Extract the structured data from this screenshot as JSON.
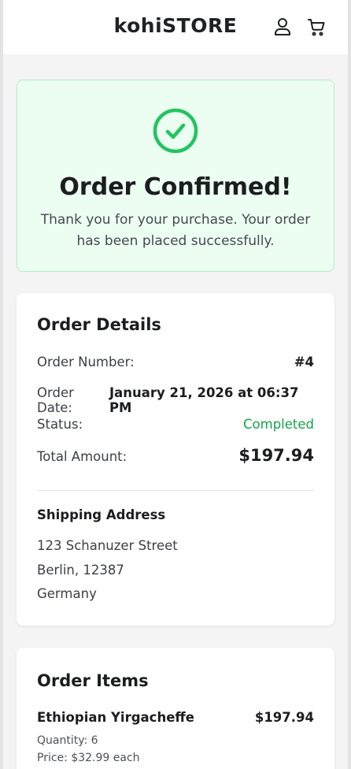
{
  "header": {
    "brand": "kohiSTORE",
    "icons": [
      "user-icon",
      "cart-icon"
    ]
  },
  "confirmation": {
    "icon": "check-circle-icon",
    "title": "Order Confirmed!",
    "message": "Thank you for your purchase. Your order has been placed successfully.",
    "accent_color": "#22c55e"
  },
  "order_details": {
    "title": "Order Details",
    "rows": [
      {
        "label": "Order Number:",
        "value": "#4"
      },
      {
        "label": "Order Date:",
        "value": "January 21, 2026 at 06:37 PM"
      },
      {
        "label": "Status:",
        "value": "Completed"
      },
      {
        "label": "Total Amount:",
        "value": "$197.94"
      }
    ],
    "status_color": "#16a34a",
    "shipping": {
      "title": "Shipping Address",
      "lines": [
        "123 Schanuzer Street",
        "Berlin, 12387",
        "Germany"
      ]
    }
  },
  "order_items": {
    "title": "Order Items",
    "items": [
      {
        "name": "Ethiopian Yirgacheffe",
        "total": "$197.94",
        "quantity": "Quantity: 6",
        "price": "Price: $32.99 each"
      }
    ]
  }
}
